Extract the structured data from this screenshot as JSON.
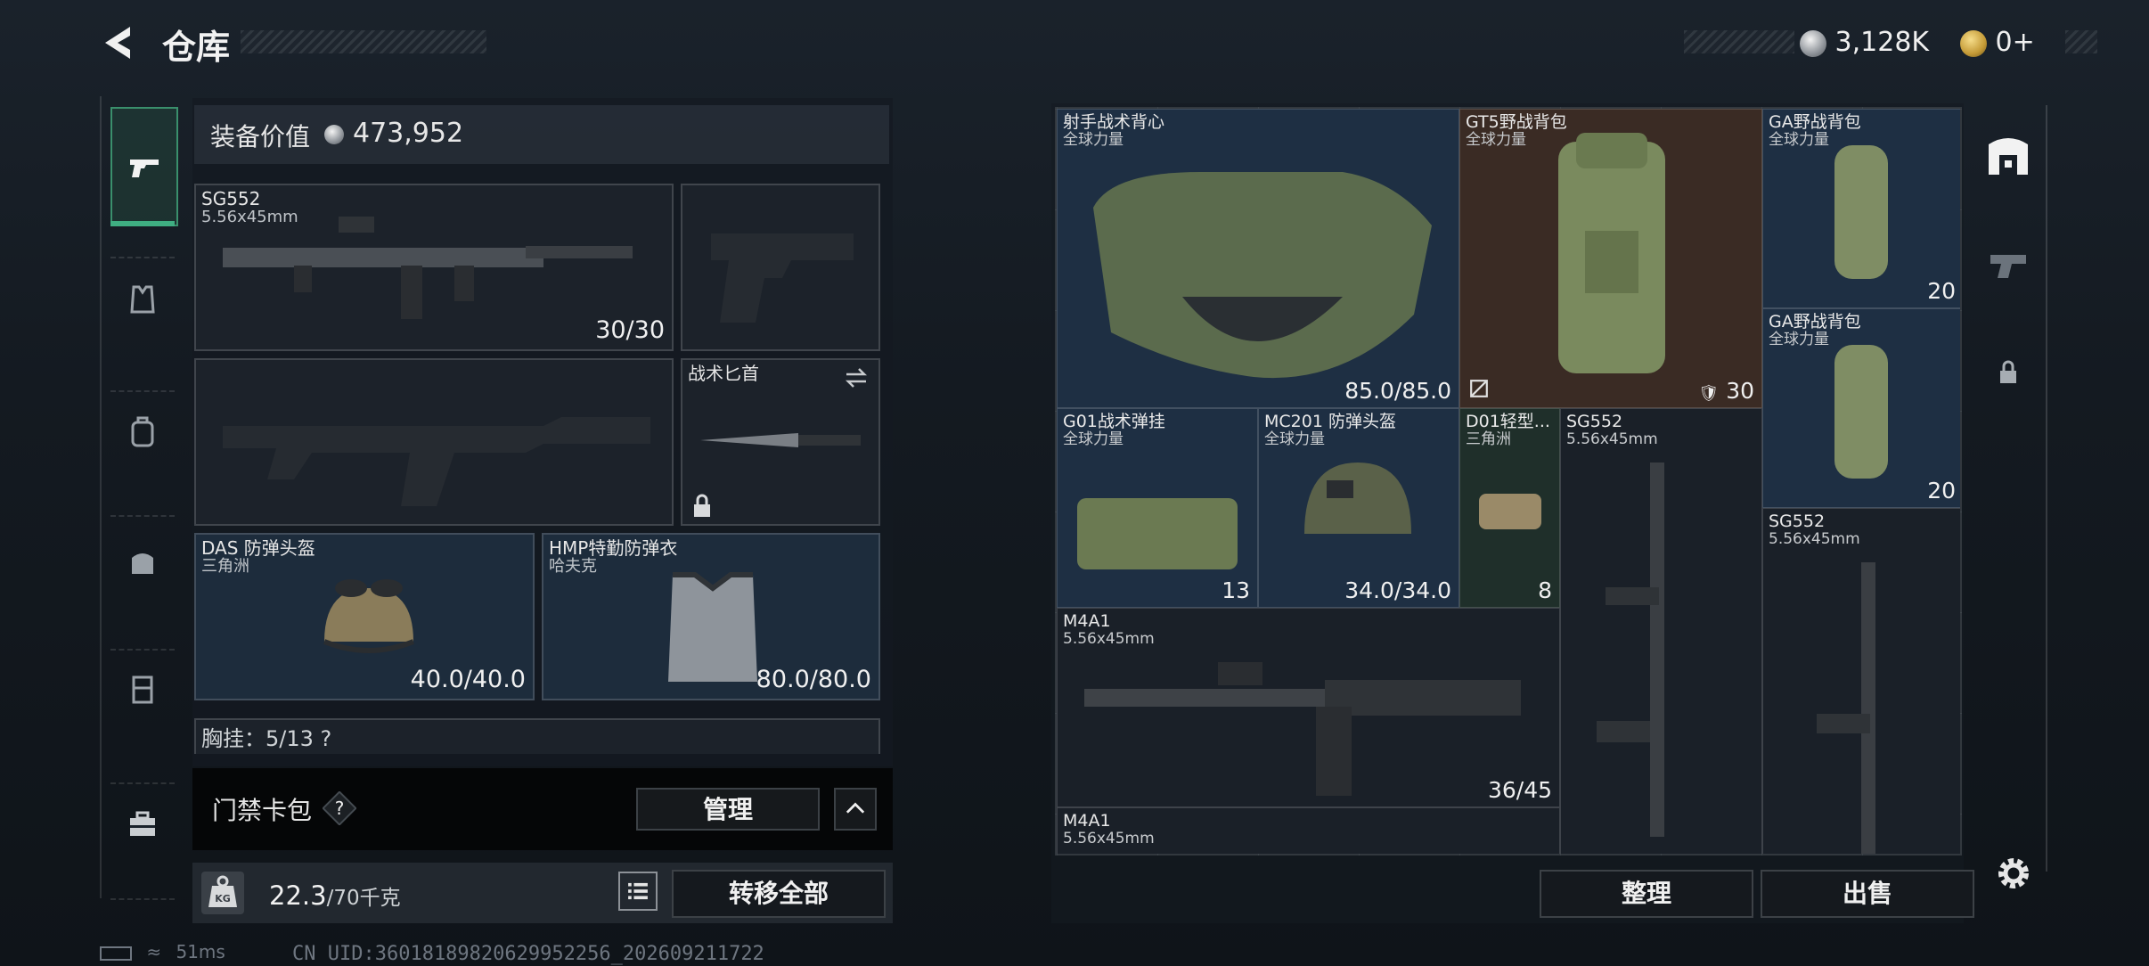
{
  "header": {
    "title": "仓库",
    "back_icon": "back-arrow-icon"
  },
  "currency": {
    "silver": "3,128K",
    "gold": "0+"
  },
  "categories": [
    "pistol-icon",
    "vest-icon",
    "backpack-icon",
    "bag-icon",
    "container-icon",
    "toolbox-icon"
  ],
  "equipment": {
    "value_label": "装备价值",
    "value": "473,952",
    "slots": [
      {
        "name": "SG552",
        "sub": "5.56x45mm",
        "value": "30/30"
      },
      {
        "name": "",
        "sub": "",
        "value": ""
      },
      {
        "name": "",
        "sub": "",
        "value": ""
      },
      {
        "name": "战术匕首",
        "sub": "",
        "value": ""
      },
      {
        "name": "DAS 防弹头盔",
        "sub": "三角洲",
        "value": "40.0/40.0"
      },
      {
        "name": "HMP特勤防弹衣",
        "sub": "哈夫克",
        "value": "80.0/80.0"
      }
    ],
    "chest_partial": "胸挂：5/13 ?"
  },
  "cardpack": {
    "label": "门禁卡包",
    "manage": "管理"
  },
  "weight": {
    "current": "22.3",
    "max_unit": "/70千克",
    "transfer": "转移全部"
  },
  "storage": {
    "items": [
      {
        "name": "射手战术背心",
        "sub": "全球力量",
        "value": "85.0/85.0"
      },
      {
        "name": "GT5野战背包",
        "sub": "全球力量",
        "value": "30"
      },
      {
        "name": "GA野战背包",
        "sub": "全球力量",
        "value": "20"
      },
      {
        "name": "GA野战背包",
        "sub": "全球力量",
        "value": "20"
      },
      {
        "name": "G01战术弹挂",
        "sub": "全球力量",
        "value": "13"
      },
      {
        "name": "MC201 防弹头盔",
        "sub": "全球力量",
        "value": "34.0/34.0"
      },
      {
        "name": "D01轻型...",
        "sub": "三角洲",
        "value": "8"
      },
      {
        "name": "SG552",
        "sub": "5.56x45mm",
        "value": ""
      },
      {
        "name": "SG552",
        "sub": "5.56x45mm",
        "value": ""
      },
      {
        "name": "M4A1",
        "sub": "5.56x45mm",
        "value": "36/45"
      },
      {
        "name": "M4A1",
        "sub": "5.56x45mm",
        "value": ""
      }
    ],
    "sort": "整理",
    "sell": "出售"
  },
  "status": {
    "ping": "51ms",
    "uid": "CN UID:36018189820629952256_202609211722"
  }
}
